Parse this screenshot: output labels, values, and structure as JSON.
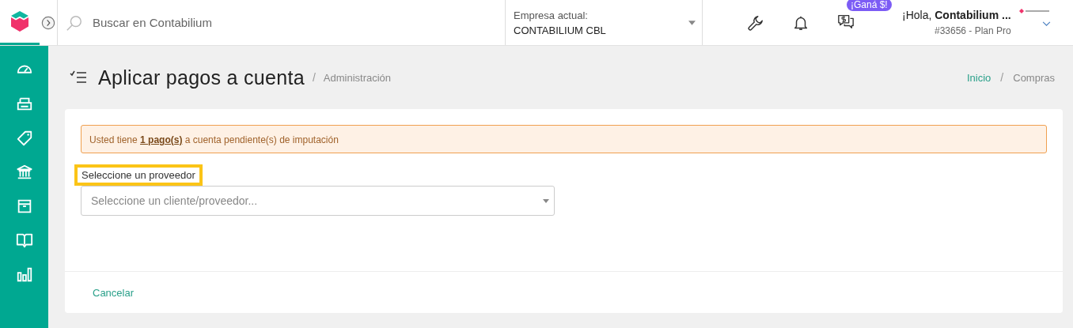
{
  "topbar": {
    "search": {
      "placeholder": "Buscar en Contabilium"
    },
    "company": {
      "label": "Empresa actual:",
      "value": "CONTABILIUM CBL"
    },
    "promo_badge": "¡Ganá $!",
    "user": {
      "greeting": "¡Hola, ",
      "name": "Contabilium ...",
      "account": "#33656 - Plan Pro"
    }
  },
  "page_header": {
    "title": "Aplicar pagos a cuenta",
    "separator": "/",
    "section": "Administración",
    "breadcrumb_separator": "/",
    "breadcrumb": [
      {
        "label": "Inicio",
        "link": true
      },
      {
        "label": "Compras",
        "link": false
      }
    ]
  },
  "alert": {
    "before": "Usted tiene ",
    "link": "1 pago(s)",
    "after": " a cuenta pendiente(s) de imputación"
  },
  "form": {
    "label": "Seleccione un proveedor",
    "label_highlighted": true,
    "select": {
      "placeholder": "Seleccione un cliente/proveedor..."
    }
  },
  "footer": {
    "cancel": "Cancelar"
  }
}
